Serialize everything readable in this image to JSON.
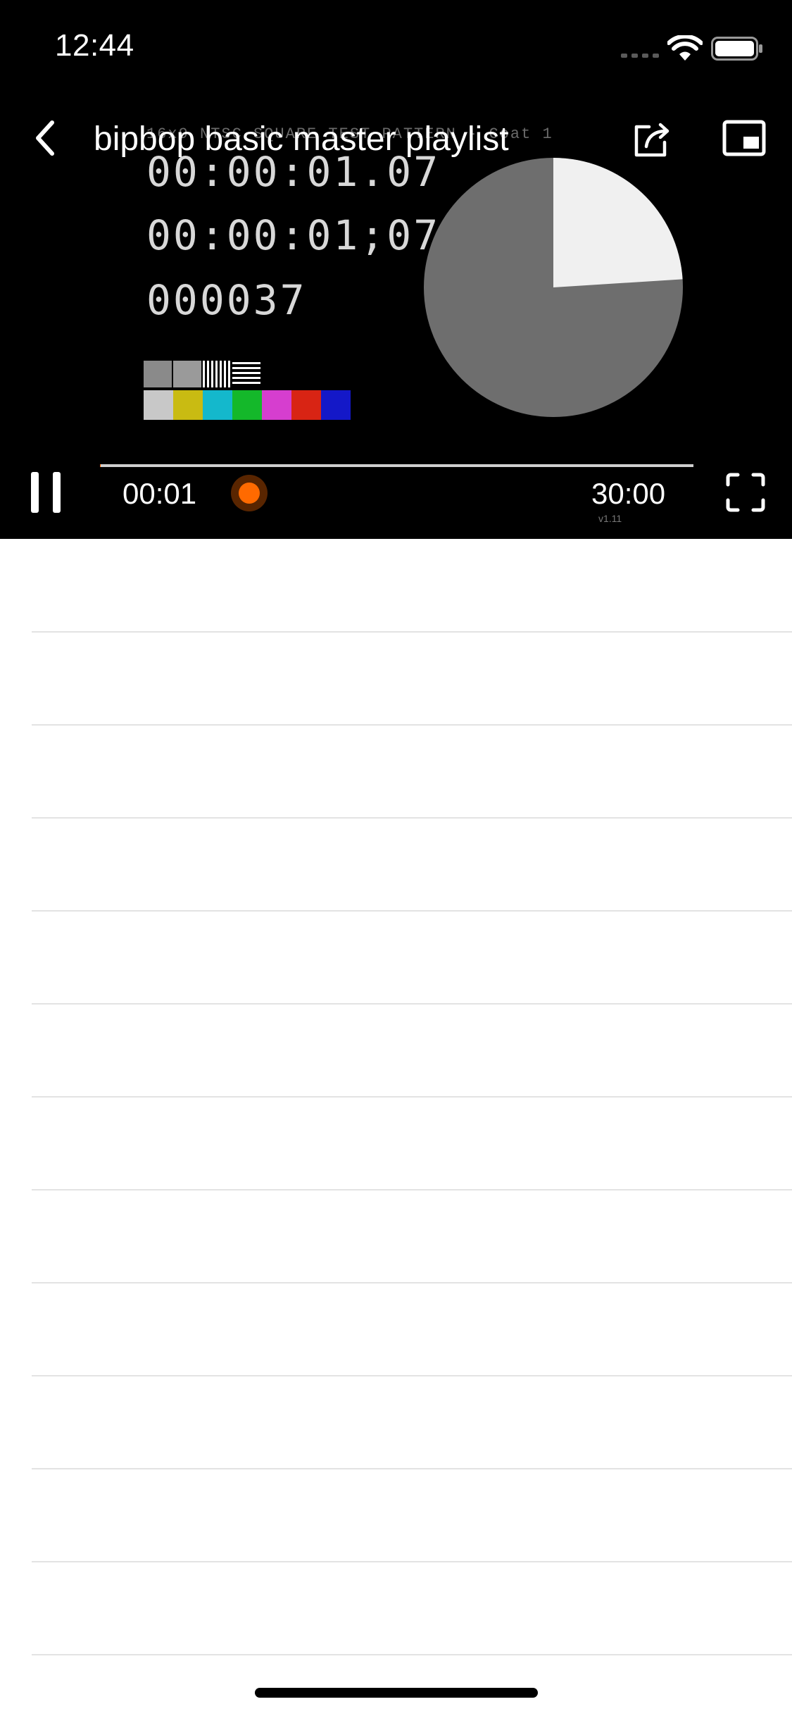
{
  "status_bar": {
    "time": "12:44"
  },
  "header": {
    "title": "bipbop basic master playlist"
  },
  "video": {
    "caption": "16x9 NTSC SQUARE TEST PATTERN - Coat 1",
    "timecode_1": "00:00:01.07",
    "timecode_2": "00:00:01;07",
    "frame_count": "000037",
    "version": "v1.11",
    "pie_white_fraction": 0.24
  },
  "controls": {
    "current_time": "00:01",
    "total_time": "30:00",
    "progress_fraction": 0.0006
  },
  "colors": {
    "accent": "#ff6a00",
    "player_background": "#000000",
    "list_separator": "#e3e3e3"
  },
  "icons": {
    "back": "chevron-left-icon",
    "share": "share-icon",
    "pip": "picture-in-picture-icon",
    "pause": "pause-icon",
    "fullscreen": "fullscreen-icon"
  },
  "list": {
    "rows": [
      "",
      "",
      "",
      "",
      "",
      "",
      "",
      "",
      "",
      "",
      "",
      ""
    ]
  }
}
